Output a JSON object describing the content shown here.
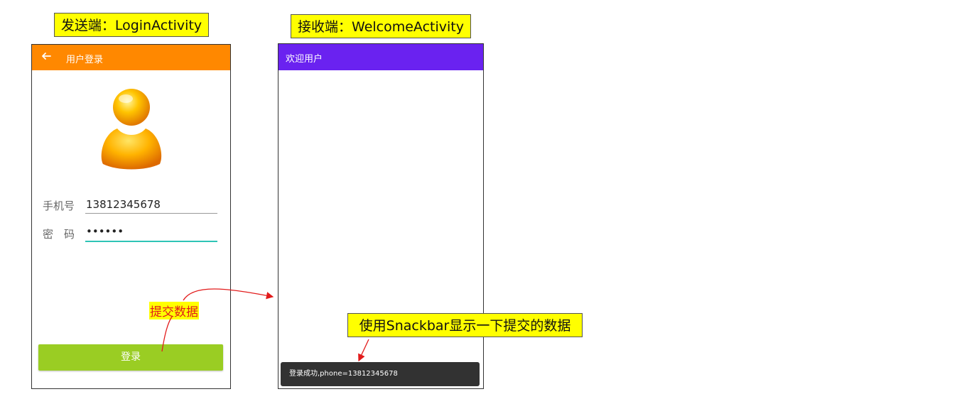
{
  "labels": {
    "sender": "发送端：LoginActivity",
    "receiver": "接收端：WelcomeActivity",
    "submit": "提交数据",
    "snackbar_note": "使用Snackbar显示一下提交的数据"
  },
  "sender": {
    "appbar_title": "用户登录",
    "phone_label": "手机号",
    "phone_value": "13812345678",
    "password_label": "密　码",
    "password_value": "••••••",
    "login_button": "登录"
  },
  "receiver": {
    "appbar_title": "欢迎用户",
    "snackbar_text": "登录成功,phone=13812345678"
  },
  "colors": {
    "sender_appbar": "#ff8800",
    "receiver_appbar": "#6a22f0",
    "login_button": "#9acd23",
    "snackbar": "#323232",
    "callout": "#ffff00",
    "arrow": "#e21b1b",
    "focus_underline": "#2ec4b6"
  },
  "icons": {
    "back": "arrow-left-icon",
    "avatar": "user-avatar-icon"
  }
}
